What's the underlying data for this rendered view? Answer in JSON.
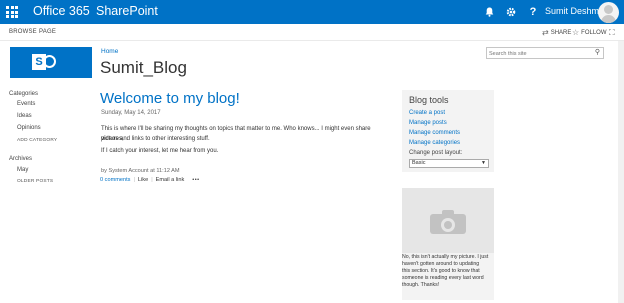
{
  "suitebar": {
    "brand": "Office 365",
    "app": "SharePoint",
    "user_name": "Sumit Deshmukh",
    "icons": [
      "waffle-icon",
      "bell-icon",
      "gear-icon",
      "help-icon"
    ],
    "help_glyph": "?",
    "color": "#0072c6"
  },
  "ribbon": {
    "tabs": [
      "BROWSE",
      "PAGE"
    ],
    "share_label": "SHARE",
    "follow_label": "FOLLOW"
  },
  "header": {
    "home_link": "Home",
    "site_title": "Sumit_Blog",
    "search_placeholder": "Search this site"
  },
  "left_nav": {
    "categories_heading": "Categories",
    "categories": [
      "Events",
      "Ideas",
      "Opinions"
    ],
    "add_category": "ADD CATEGORY",
    "archives_heading": "Archives",
    "archives": [
      "May"
    ],
    "older_posts": "OLDER POSTS"
  },
  "post": {
    "title": "Welcome to my blog!",
    "date": "Sunday, May 14, 2017",
    "body_1a": "This is where I'll be sharing my thoughts on topics that matter to me. Who knows... I might even share pictures,",
    "body_1b": "videos and links to other interesting stuff.",
    "body_2": "If I catch your interest, let me hear from you.",
    "byline": "by System Account at 11:12 AM",
    "comments": "0 comments",
    "like": "Like",
    "email": "Email a link",
    "more": "•••"
  },
  "blog_tools": {
    "title": "Blog tools",
    "links": [
      "Create a post",
      "Manage posts",
      "Manage comments",
      "Manage categories"
    ],
    "layout_label": "Change post layout:",
    "layout_value": "Basic"
  },
  "profile": {
    "text_lines": [
      "No, this isn't actually my picture. I just",
      "haven't gotten around to updating",
      "this section. It's good to know that",
      "someone is reading every last word",
      "though. Thanks!"
    ]
  }
}
